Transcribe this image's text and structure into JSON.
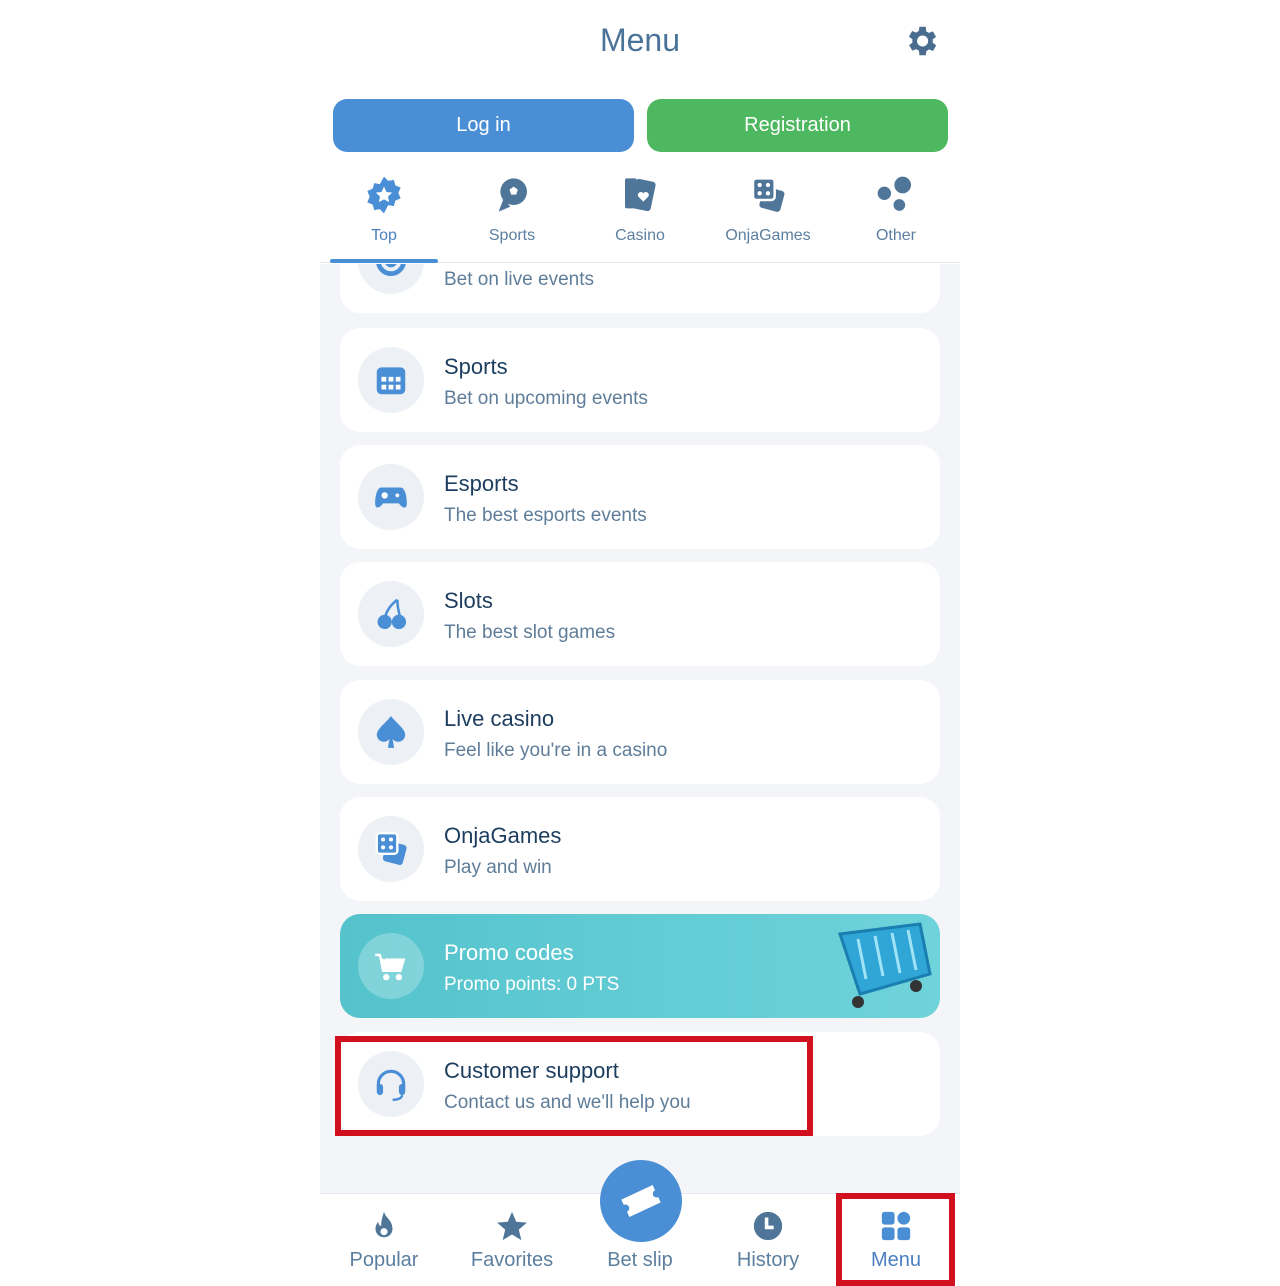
{
  "header": {
    "title": "Menu",
    "settings_icon": "gear-icon"
  },
  "auth": {
    "login": "Log in",
    "register": "Registration"
  },
  "tabs": [
    {
      "label": "Top",
      "icon": "star-badge-icon",
      "active": true
    },
    {
      "label": "Sports",
      "icon": "soccer-ball-icon"
    },
    {
      "label": "Casino",
      "icon": "cards-icon"
    },
    {
      "label": "OnjaGames",
      "icon": "dice-icon"
    },
    {
      "label": "Other",
      "icon": "bubbles-icon"
    }
  ],
  "items": [
    {
      "subtitle": "Bet on live events",
      "icon": "live-icon"
    },
    {
      "title": "Sports",
      "subtitle": "Bet on upcoming events",
      "icon": "calendar-icon"
    },
    {
      "title": "Esports",
      "subtitle": "The best esports events",
      "icon": "gamepad-icon"
    },
    {
      "title": "Slots",
      "subtitle": "The best slot games",
      "icon": "cherry-icon"
    },
    {
      "title": "Live casino",
      "subtitle": "Feel like you're in a casino",
      "icon": "spade-icon"
    },
    {
      "title": "OnjaGames",
      "subtitle": "Play and win",
      "icon": "dice-icon"
    },
    {
      "title": "Promo codes",
      "subtitle": "Promo points: 0 PTS",
      "icon": "cart-icon"
    },
    {
      "title": "Customer support",
      "subtitle": "Contact us and we'll help you",
      "icon": "headset-icon"
    }
  ],
  "nav": [
    {
      "label": "Popular",
      "icon": "flame-icon"
    },
    {
      "label": "Favorites",
      "icon": "star-icon"
    },
    {
      "label": "Bet slip",
      "icon": "ticket-icon"
    },
    {
      "label": "History",
      "icon": "clock-icon"
    },
    {
      "label": "Menu",
      "icon": "grid-icon",
      "active": true
    }
  ],
  "colors": {
    "accent": "#4a8fd6",
    "register": "#4db85f",
    "highlight": "#d0101f",
    "promo": "#54c3cc"
  }
}
